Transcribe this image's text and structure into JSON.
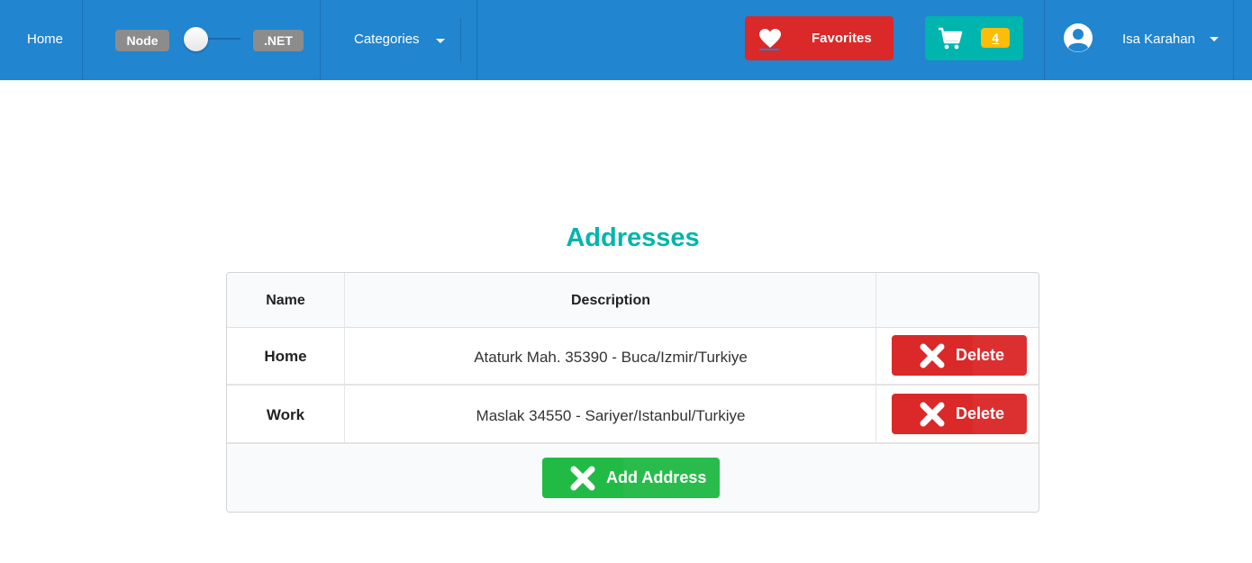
{
  "nav": {
    "home": "Home",
    "toggle": {
      "left_label": "Node",
      "right_label": ".NET",
      "state": "Node"
    },
    "categories": "Categories",
    "favorites": "Favorites",
    "cart_count": "4",
    "user_name": "Isa Karahan"
  },
  "main": {
    "title": "Addresses",
    "columns": {
      "name": "Name",
      "description": "Description"
    },
    "rows": [
      {
        "name": "Home",
        "description": "Ataturk Mah. 35390 - Buca/Izmir/Turkiye",
        "action": "Delete"
      },
      {
        "name": "Work",
        "description": "Maslak 34550 - Sariyer/Istanbul/Turkiye",
        "action": "Delete"
      }
    ],
    "add_button": "Add Address"
  },
  "colors": {
    "navbar": "#2185d0",
    "favorites": "#db2828",
    "cart": "#00b5ad",
    "badge": "#fbbd08",
    "title": "#00b5ad",
    "delete": "#db2828",
    "add": "#21ba45"
  },
  "icons": {
    "favorites": "heart-icon",
    "cart": "shopping-cart-icon",
    "user": "user-circle-icon",
    "delete": "close-icon",
    "add": "close-icon"
  }
}
